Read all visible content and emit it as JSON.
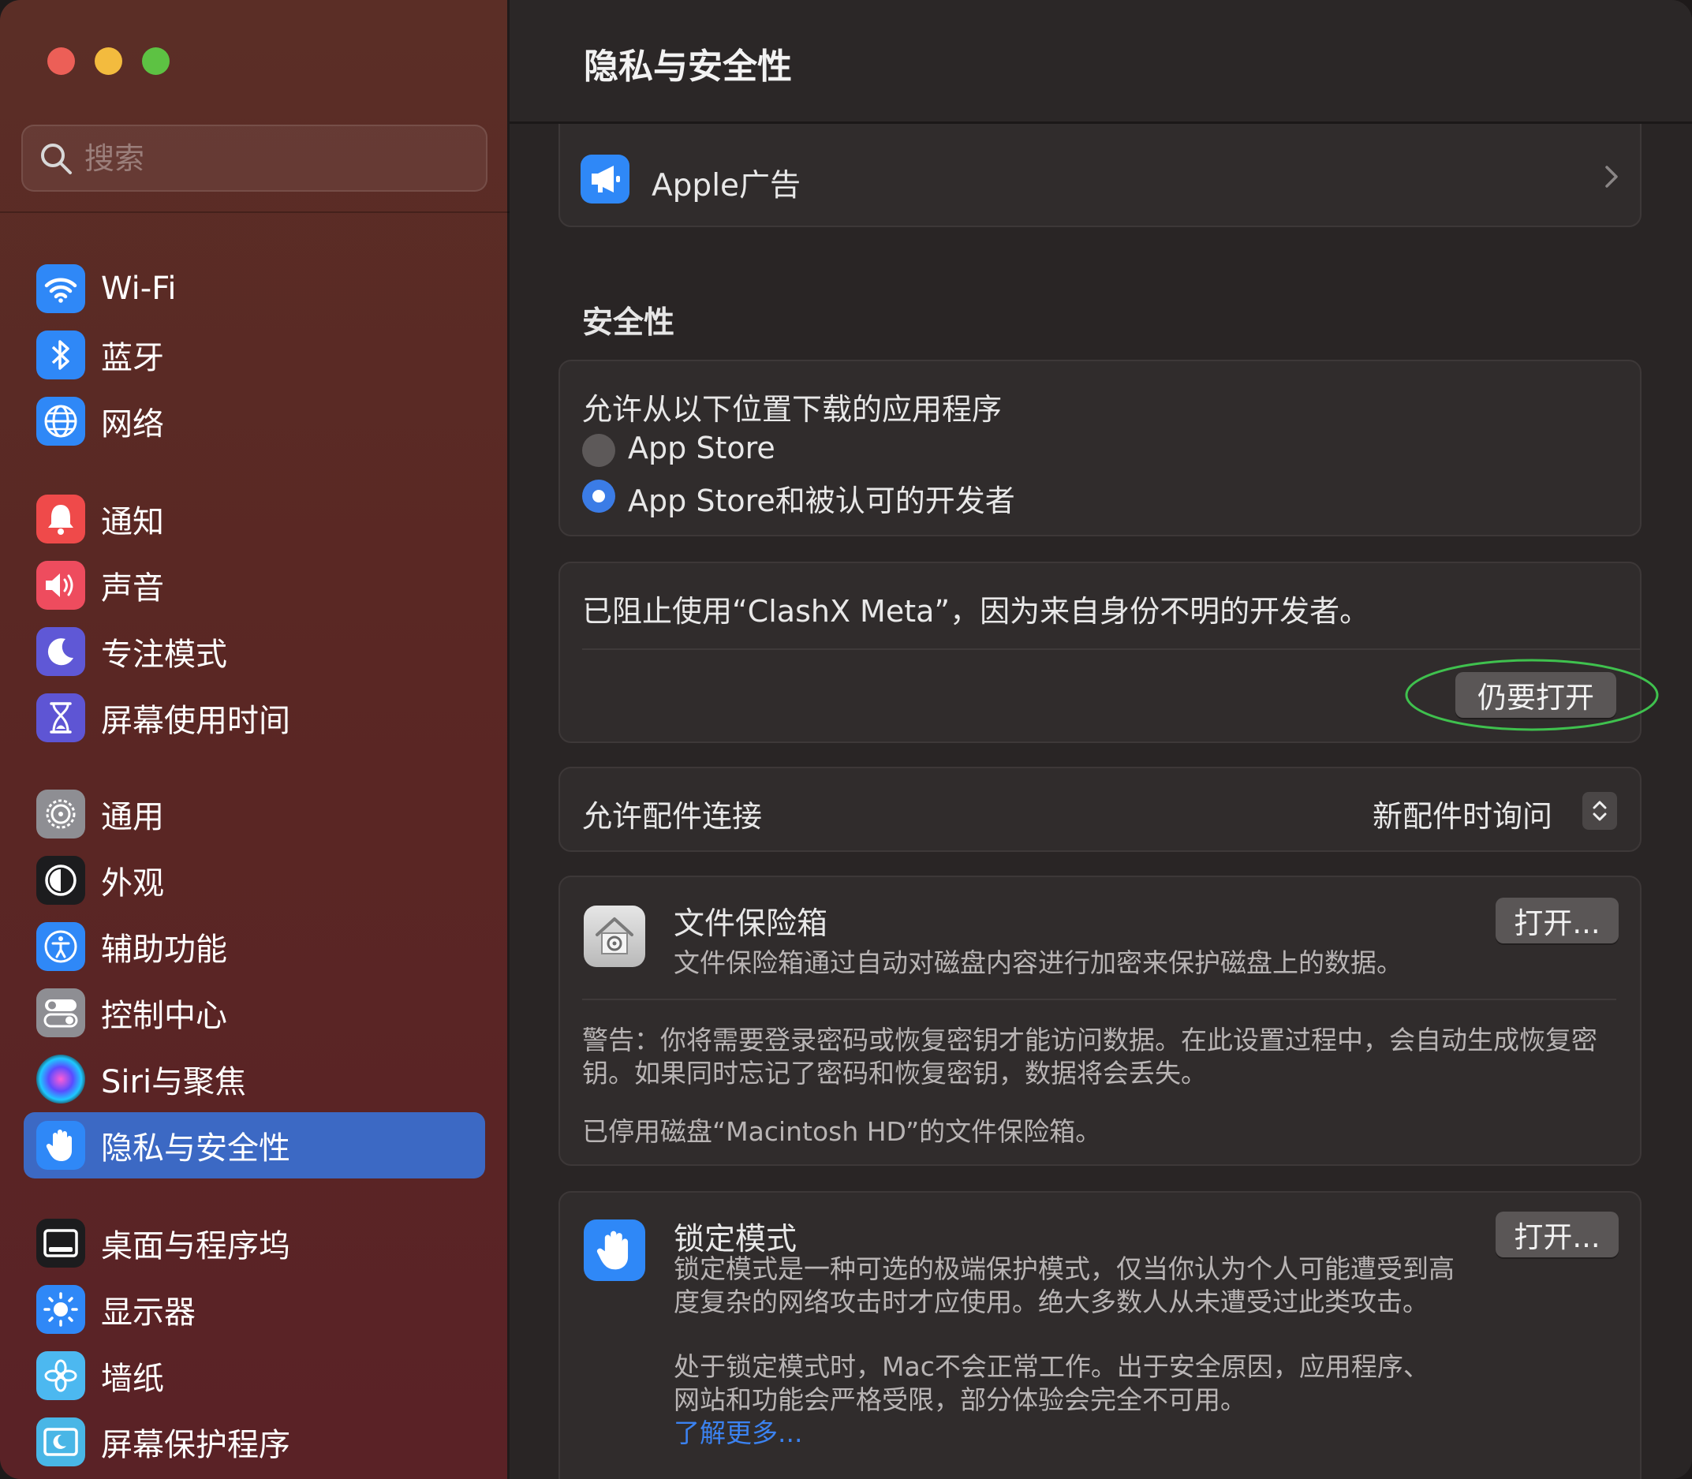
{
  "window": {
    "title": "隐私与安全性"
  },
  "colors": {
    "accent": "#3c69c4",
    "link": "#3b82f0",
    "highlight_ring": "#3fc14e"
  },
  "search": {
    "placeholder": "搜索"
  },
  "sidebar": {
    "items": [
      {
        "label": "Wi-Fi",
        "icon": "wifi-icon"
      },
      {
        "label": "蓝牙",
        "icon": "bluetooth-icon"
      },
      {
        "label": "网络",
        "icon": "globe-icon"
      },
      {
        "label": "通知",
        "icon": "bell-icon"
      },
      {
        "label": "声音",
        "icon": "speaker-icon"
      },
      {
        "label": "专注模式",
        "icon": "moon-icon"
      },
      {
        "label": "屏幕使用时间",
        "icon": "hourglass-icon"
      },
      {
        "label": "通用",
        "icon": "gear-icon"
      },
      {
        "label": "外观",
        "icon": "appearance-icon"
      },
      {
        "label": "辅助功能",
        "icon": "accessibility-icon"
      },
      {
        "label": "控制中心",
        "icon": "toggles-icon"
      },
      {
        "label": "Siri与聚焦",
        "icon": "siri-icon"
      },
      {
        "label": "隐私与安全性",
        "icon": "hand-icon",
        "selected": true
      },
      {
        "label": "桌面与程序坞",
        "icon": "dock-icon"
      },
      {
        "label": "显示器",
        "icon": "sun-icon"
      },
      {
        "label": "墙纸",
        "icon": "flower-icon"
      },
      {
        "label": "屏幕保护程序",
        "icon": "screensaver-icon"
      }
    ]
  },
  "apple_ads": {
    "label": "Apple广告"
  },
  "security": {
    "section_title": "安全性",
    "allow_downloads_label": "允许从以下位置下载的应用程序",
    "options": [
      {
        "label": "App Store",
        "selected": false
      },
      {
        "label": "App Store和被认可的开发者",
        "selected": true
      }
    ],
    "blocked_message": "已阻止使用“ClashX Meta”，因为来自身份不明的开发者。",
    "open_anyway_label": "仍要打开",
    "accessory_label": "允许配件连接",
    "accessory_value": "新配件时询问"
  },
  "filevault": {
    "title": "文件保险箱",
    "description": "文件保险箱通过自动对磁盘内容进行加密来保护磁盘上的数据。",
    "button": "打开...",
    "warning_line1": "警告：你将需要登录密码或恢复密钥才能访问数据。在此设置过程中，会自动生成恢复密",
    "warning_line2": "钥。如果同时忘记了密码和恢复密钥，数据将会丢失。",
    "status": "已停用磁盘“Macintosh HD”的文件保险箱。"
  },
  "lockdown": {
    "title": "锁定模式",
    "button": "打开...",
    "desc_line1": "锁定模式是一种可选的极端保护模式，仅当你认为个人可能遭受到高",
    "desc_line2": "度复杂的网络攻击时才应使用。绝大多数人从未遭受过此类攻击。",
    "note_line1": "处于锁定模式时，Mac不会正常工作。出于安全原因，应用程序、",
    "note_line2": "网站和功能会严格受限，部分体验会完全不可用。",
    "learn_more": "了解更多..."
  }
}
